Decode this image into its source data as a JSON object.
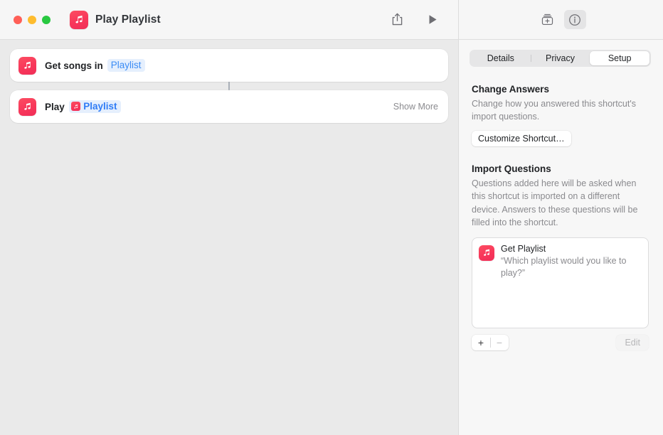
{
  "window": {
    "title": "Play Playlist",
    "app_icon": "music-note-icon",
    "traffic_lights": [
      "close",
      "minimize",
      "zoom"
    ],
    "colors": {
      "accent_blue": "#3b8cf5",
      "music_red": "#f8375a",
      "editor_bg": "#eaeaea",
      "inspector_bg": "#f7f7f7",
      "card_bg": "#ffffff"
    }
  },
  "toolbar": {
    "share_icon": "share-icon",
    "run_icon": "play-icon",
    "action_library_icon": "action-library-icon",
    "info_icon": "info-circle-icon",
    "info_selected": true
  },
  "editor": {
    "actions": [
      {
        "icon": "music-note-icon",
        "prefix": "Get songs in",
        "token": "Playlist",
        "token_has_icon": false,
        "show_more": null
      },
      {
        "icon": "music-note-icon",
        "prefix": "Play",
        "token": "Playlist",
        "token_has_icon": true,
        "show_more": "Show More"
      }
    ]
  },
  "inspector": {
    "tabs": [
      {
        "label": "Details",
        "active": false
      },
      {
        "label": "Privacy",
        "active": false
      },
      {
        "label": "Setup",
        "active": true
      }
    ],
    "change_answers": {
      "title": "Change Answers",
      "description": "Change how you answered this shortcut's import questions.",
      "button": "Customize Shortcut…"
    },
    "import_questions": {
      "title": "Import Questions",
      "description": "Questions added here will be asked when this shortcut is imported on a different device. Answers to these questions will be filled into the shortcut.",
      "items": [
        {
          "icon": "music-note-icon",
          "title": "Get Playlist",
          "question": "“Which playlist would you like to play?”"
        }
      ],
      "add_label": "+",
      "remove_label": "−",
      "edit_label": "Edit",
      "edit_enabled": false,
      "remove_enabled": false
    }
  }
}
